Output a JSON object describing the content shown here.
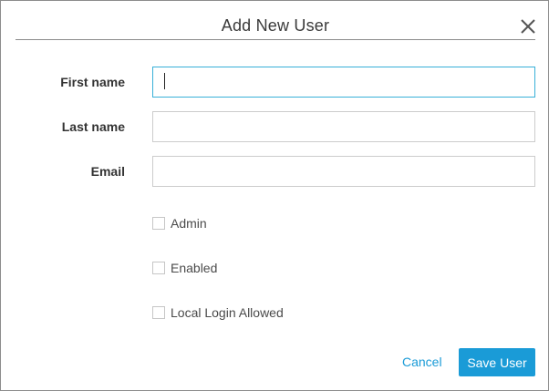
{
  "dialog": {
    "title": "Add New User",
    "close_icon": "close-icon"
  },
  "form": {
    "first_name": {
      "label": "First name",
      "value": "",
      "placeholder": ""
    },
    "last_name": {
      "label": "Last name",
      "value": "",
      "placeholder": ""
    },
    "email": {
      "label": "Email",
      "value": "",
      "placeholder": ""
    }
  },
  "options": {
    "admin": {
      "label": "Admin",
      "checked": false
    },
    "enabled": {
      "label": "Enabled",
      "checked": false
    },
    "local_login": {
      "label": "Local Login Allowed",
      "checked": false
    }
  },
  "actions": {
    "cancel_label": "Cancel",
    "save_label": "Save User"
  },
  "colors": {
    "accent": "#1a9bd7",
    "focus_border": "#38b0d8",
    "divider": "#8a8a8a"
  }
}
